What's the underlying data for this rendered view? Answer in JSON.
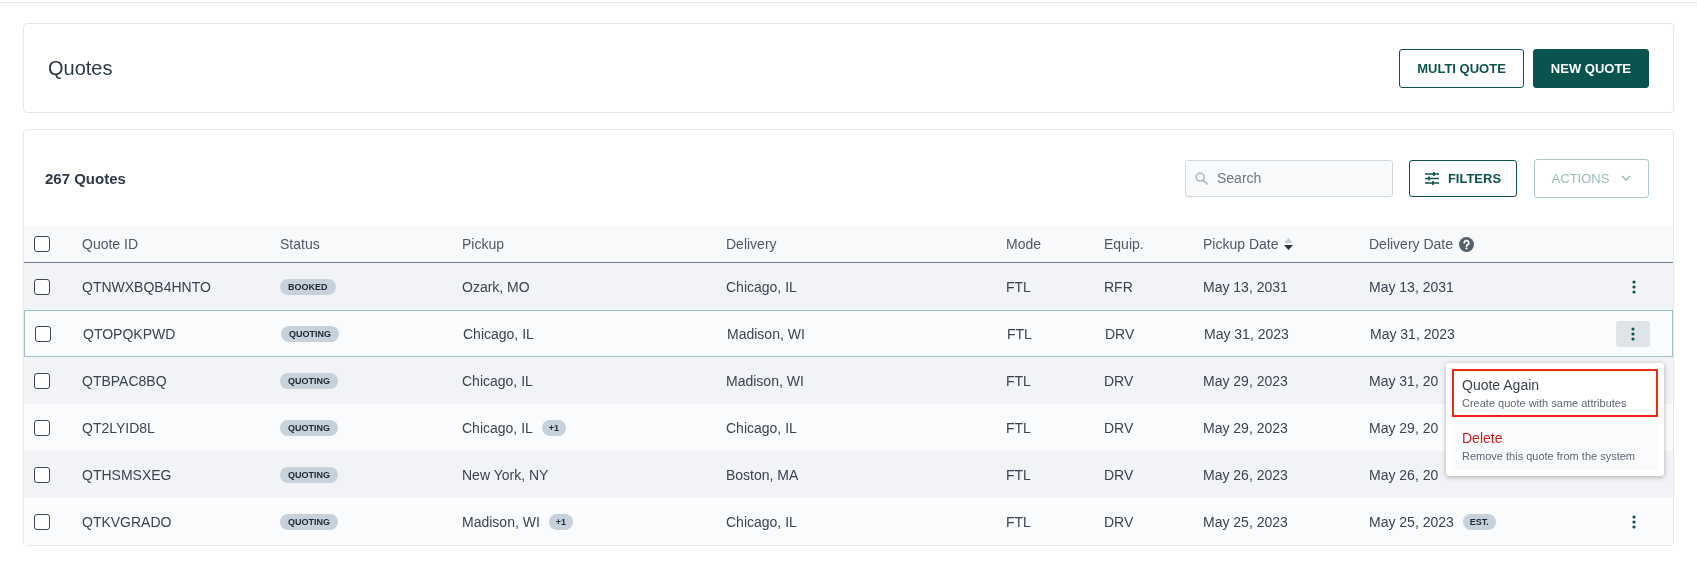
{
  "header": {
    "title": "Quotes",
    "buttons": [
      {
        "label": "MULTI QUOTE",
        "kind": "outline"
      },
      {
        "label": "NEW QUOTE",
        "kind": "primary"
      }
    ]
  },
  "list": {
    "count_label": "267 Quotes",
    "search": {
      "placeholder": "Search"
    },
    "filters_button": "FILTERS",
    "actions_button": {
      "label": "ACTIONS",
      "disabled": true
    }
  },
  "table": {
    "all_checked": false,
    "columns": [
      {
        "label": "Quote ID"
      },
      {
        "label": "Status"
      },
      {
        "label": "Pickup"
      },
      {
        "label": "Delivery"
      },
      {
        "label": "Mode"
      },
      {
        "label": "Equip."
      },
      {
        "label": "Pickup Date",
        "sorted": true
      },
      {
        "label": "Delivery Date",
        "help": true
      }
    ],
    "rows": [
      {
        "checked": false,
        "id": "QTNWXBQB4HNTO",
        "status": "BOOKED",
        "pickup": "Ozark, MO",
        "delivery": "Chicago, IL",
        "mode": "FTL",
        "equip": "RFR",
        "pickup_date": "May 13, 2031",
        "delivery_date": "May 13, 2031",
        "menu_open": false,
        "menu_button_visible": true
      },
      {
        "checked": false,
        "id": "QTOPQKPWD",
        "status": "QUOTING",
        "pickup": "Chicago, IL",
        "delivery": "Madison, WI",
        "mode": "FTL",
        "equip": "DRV",
        "pickup_date": "May 31, 2023",
        "delivery_date": "May 31, 2023",
        "menu_open": true,
        "menu_button_visible": true
      },
      {
        "checked": false,
        "id": "QTBPAC8BQ",
        "status": "QUOTING",
        "pickup": "Chicago, IL",
        "delivery": "Madison, WI",
        "mode": "FTL",
        "equip": "DRV",
        "pickup_date": "May 29, 2023",
        "delivery_date": "May 31, 20",
        "menu_open": false,
        "menu_button_visible": false
      },
      {
        "checked": false,
        "id": "QT2LYID8L",
        "status": "QUOTING",
        "pickup": "Chicago, IL",
        "pickup_extra": "+1",
        "delivery": "Chicago, IL",
        "mode": "FTL",
        "equip": "DRV",
        "pickup_date": "May 29, 2023",
        "delivery_date": "May 29, 20",
        "menu_open": false,
        "menu_button_visible": false
      },
      {
        "checked": false,
        "id": "QTHSMSXEG",
        "status": "QUOTING",
        "pickup": "New York, NY",
        "delivery": "Boston, MA",
        "mode": "FTL",
        "equip": "DRV",
        "pickup_date": "May 26, 2023",
        "delivery_date": "May 26, 20",
        "menu_open": false,
        "menu_button_visible": false
      },
      {
        "checked": false,
        "id": "QTKVGRADO",
        "status": "QUOTING",
        "pickup": "Madison, WI",
        "pickup_extra": "+1",
        "delivery": "Chicago, IL",
        "mode": "FTL",
        "equip": "DRV",
        "pickup_date": "May 25, 2023",
        "delivery_date": "May 25, 2023",
        "delivery_badge": "EST.",
        "menu_open": false,
        "menu_button_visible": true
      }
    ]
  },
  "row_menu": {
    "items": [
      {
        "kind": "normal",
        "label": "Quote Again",
        "description": "Create quote with same attributes",
        "highlighted": true
      },
      {
        "kind": "danger",
        "label": "Delete",
        "description": "Remove this quote from the system",
        "highlighted": false
      }
    ]
  }
}
